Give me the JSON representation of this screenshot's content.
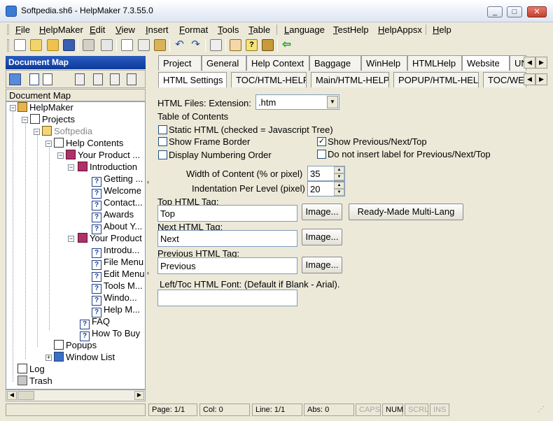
{
  "window": {
    "title": "Softpedia.sh6 - HelpMaker 7.3.55.0",
    "controls": [
      "_",
      "□",
      "✕"
    ]
  },
  "menu": [
    "File",
    "HelpMaker",
    "Edit",
    "View",
    "Insert",
    "Format",
    "Tools",
    "Table",
    "Language",
    "TestHelp",
    "HelpAppsx",
    "Help"
  ],
  "left_panel": {
    "header": "Document Map",
    "label": "Document Map",
    "tree": {
      "root": "HelpMaker",
      "projects": "Projects",
      "project": "Softpedia",
      "help_contents": "Help Contents",
      "your_product_a": "Your Product ...",
      "introduction": "Introduction",
      "intro_items": [
        "Getting ...",
        "Welcome",
        "Contact...",
        "Awards",
        "About Y..."
      ],
      "your_product_b": "Your Product",
      "product_items": [
        "Introdu...",
        "File Menu",
        "Edit Menu",
        "Tools M...",
        "Windo...",
        "Help M..."
      ],
      "faq": "FAQ",
      "how_to_buy": "How To Buy",
      "popups": "Popups",
      "window_list": "Window List",
      "log": "Log",
      "trash": "Trash"
    }
  },
  "tabs_row1": [
    "Project",
    "General",
    "Help Context",
    "Baggage",
    "WinHelp",
    "HTMLHelp",
    "Website",
    "UN"
  ],
  "tabs_row2": [
    "HTML Settings",
    "TOC/HTML-HELP",
    "Main/HTML-HELP",
    "POPUP/HTML-HELP",
    "TOC/WE"
  ],
  "html_settings": {
    "ext_label": "HTML Files: Extension:",
    "ext_value": ".htm",
    "toc_label": "Table of Contents",
    "checkboxes": [
      {
        "label": "Static HTML (checked = Javascript Tree)",
        "checked": false
      },
      {
        "label": "Show Frame Border",
        "checked": false
      },
      {
        "label": "Show Previous/Next/Top",
        "checked": true
      },
      {
        "label": "Display Numbering Order",
        "checked": false
      },
      {
        "label": "Do not insert label for Previous/Next/Top",
        "checked": false
      }
    ],
    "width_label": "Width of Content (% or pixel)",
    "width_value": "35",
    "indent_label": "Indentation Per Level (pixel)",
    "indent_value": "20",
    "top_label": "Top HTML Tag:",
    "top_value": "Top",
    "next_label": "Next HTML Tag:",
    "next_value": "Next",
    "prev_label": "Previous HTML Tag:",
    "prev_value": "Previous",
    "image_button": "Image...",
    "multilang_button": "Ready-Made Multi-Lang",
    "font_label": "Left/Toc HTML Font: (Default if Blank - Arial).",
    "font_value": ""
  },
  "status": {
    "page": "Page: 1/1",
    "col": "Col: 0",
    "line": "Line: 1/1",
    "abs": "Abs: 0",
    "caps": "CAPS",
    "num": "NUM",
    "scrl": "SCRL",
    "ins": "INS"
  },
  "colors": {
    "accent": "#0d3a9b",
    "window_bg": "#ece9d8"
  }
}
